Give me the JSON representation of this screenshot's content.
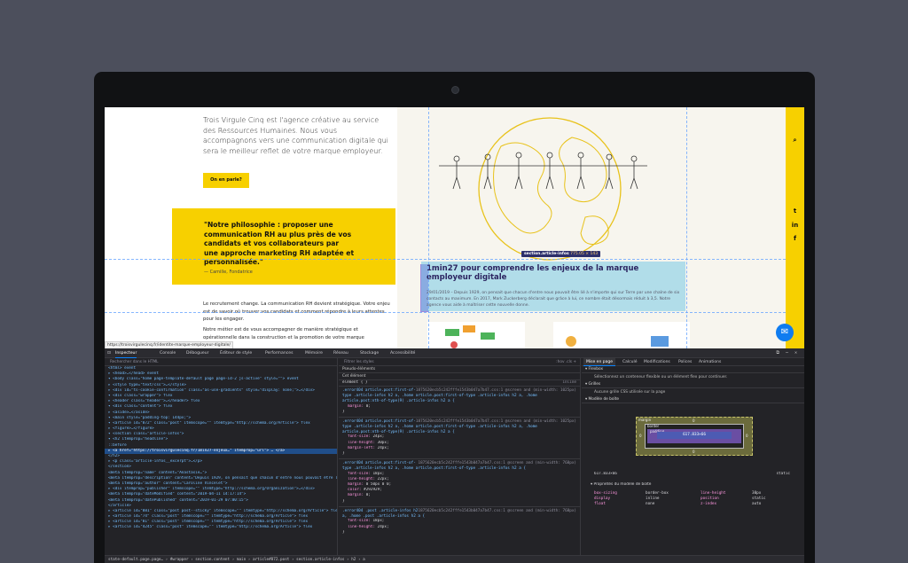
{
  "site": {
    "intro": "Trois Virgule Cinq est l'agence créative au service des Ressources Humaines. Nous vous accompagnons vers une communication digitale qui sera le meilleur reflet de votre marque employeur.",
    "cta": "On en parle?",
    "quote": "\"Notre philosophie : proposer une communication RH au plus près de vos candidats et vos collaborateurs par une approche marketing RH adaptée et personnalisée.\"",
    "quote_author": "— Camille, Fondatrice",
    "para1": "Le recrutement change. La communication RH devient stratégique. Votre enjeu est de savoir où trouver vos candidats et comment répondre à leurs attentes pour les engager.",
    "para2": "Notre métier est de vous accompagner de manière stratégique et opérationnelle dans la construction et la promotion de votre marque employeur.",
    "tooltip_label": "section.article-infos",
    "tooltip_size": "775.05 × 143",
    "article_title": "1min27 pour comprendre les enjeux de la marque employeur digitale",
    "article_excerpt": "29/01/2019 – Depuis 1929, on pensait que chacun d'entre nous pouvait être lié à n'importe qui sur Terre par une chaîne de six contacts au maximum. En 2017, Mark Zuckerberg déclarait que grâce à lui, ce nombre était désormais réduit à 3,5. Notre agence vous aide à maîtriser cette nouvelle donne.",
    "status_url": "https://troisvirgulecinq.fr/identite-marque-employeur-digitale/",
    "icons": [
      "search-icon",
      "twitter-icon",
      "linkedin-icon",
      "facebook-icon",
      "messenger-icon"
    ]
  },
  "devtools": {
    "tabs": [
      "Inspecteur",
      "Console",
      "Débogueur",
      "Éditeur de style",
      "Performances",
      "Mémoire",
      "Réseau",
      "Stockage",
      "Accessibilité"
    ],
    "search_placeholder": "Rechercher dans le HTML",
    "filter_placeholder": "Filtrer les styles",
    "filter_toggles": ":hov .cls +",
    "pseudo_header": "Pseudo-éléments",
    "this_element": "Cet élément",
    "element_rule": "élément { }",
    "inline_label": "inline",
    "html_lines": [
      "<html> event",
      "▸ <head>…</head> event",
      "▾ <body class=\"home page-template-default page page-id-2 js-active\" style=\"\"> event",
      "  ▸ <style type=\"text/css\">…</style>",
      "  ▸ <div id=\"ts-cookie-confirmation\" class=\"as-use-gradients\" style=\"display: none;\">…</div>",
      "  ▾ <div class=\"wrapper\"> flex",
      "    ▸ <header class=\"header\">…</header> flex",
      "    ▾ <div class=\"content\"> flex",
      "      ▸ <aside>…</aside>",
      "      ▾ <main style=\"padding-top: 144px;\">",
      "        ▾ <article id=\"872\" class=\"post\" itemscope=\"\" itemtype=\"http://schema.org/Article\"> flex",
      "          ▸ <figure>…</figure>",
      "          ▾ <section class=\"article-infos\">",
      "            ▾ <h2 itemprop=\"headline\">",
      "                ::before",
      "              ▸ <a href=\"https://troisvirgulecinq.fr/1min27-enjeux…\" itemprop=\"url\"> … </a>",
      "              </h2>",
      "            ▸ <p class=\"article-infos__excerpt\">…</p>",
      "          </section>",
      "          <meta itemprop=\"name\" content=\"Anastasie…\">",
      "          <meta itemprop=\"description\" content=\"Depuis 1929, on pensait que chacun d'entre nous pouvait être lié…\">",
      "          <meta itemprop=\"author\" content=\"Caroline Vincelet\">",
      "        ▸ <div itemprop=\"publisher\" itemscope=\"\" itemtype=\"http://schema.org/Organization\">…</div>",
      "          <meta itemprop=\"dateModified\" content=\"2019-04-11 14:17:14\">",
      "          <meta itemprop=\"datePublished\" content=\"2019-01-29 07:00:15\">",
      "        </article>",
      "        ▸ <article id=\"881\" class=\"post post--sticky\" itemscope=\"\" itemtype=\"http://schema.org/Article\"> flex",
      "        ▸ <article id=\"74\" class=\"post\" itemscope=\"\" itemtype=\"http://schema.org/Article\"> flex",
      "        ▸ <article id=\"81\" class=\"post\" itemscope=\"\" itemtype=\"http://schema.org/Article\"> flex",
      "        ▸ <article id=\"4245\" class=\"post\" itemscope=\"\" itemtype=\"http://schema.org/Article\"> flex"
    ],
    "breadcrumbs": "state-default.page.page… › #wrapper › section.content › main › article#872.post › section.article-infos › h2 › a",
    "css_rules": [
      {
        "sel": ".error404 article.post:first-of-type .article-infos h2 a, .home article.post:first-of-type .article-infos h2 a, .home article.post:nth-of-type(9) .article-infos h2 a",
        "src": "1875620ecb5c242fffe1543b047a7b47.css:1 @screen and (min-width: 1025px)",
        "props": [
          "margin: 0;"
        ]
      },
      {
        "sel": ".error404 article.post:first-of-type .article-infos h2 a, .home article.post:first-of-type .article-infos h2 a, .home article.post:nth-of-type(9) .article-infos h2 a",
        "src": "1875620ecb5c242fffe1543b047a7b47.css:1 @screen and (min-width: 1025px)",
        "props": [
          "font-size: 24px;",
          "line-height: 30px;",
          "margin-left: 24px;"
        ]
      },
      {
        "sel": ".error404 article.post:first-of-type .article-infos h2 a, .home article.post:first-of-type .article-infos h2 a",
        "src": "1875620ecb5c242fffe1543b047a7b47.css:1 @screen and (min-width: 768px)",
        "props": [
          "font-size: 18px;",
          "line-height: 22px;",
          "margin: 0 50px 0 0;",
          "color: #292929;",
          "margin: 0;"
        ]
      },
      {
        "sel": ".error404 .post .article-infos h2 a, .home .post .article-infos h2 a",
        "src": "1875620ecb5c242fffe1543b047a7b47.css:1 @screen and (min-width: 768px)",
        "props": [
          "font-size: 18px;",
          "line-height: 24px;"
        ]
      }
    ],
    "layout_tabs": [
      "Mise en page",
      "Calculé",
      "Modifications",
      "Polices",
      "Animations"
    ],
    "flexbox_header": "Flexbox",
    "flexbox_note": "Sélectionnez un conteneur flexible ou un élément flex pour continuer.",
    "grid_header": "Grilles",
    "grid_note": "Aucune grille CSS utilisée sur la page",
    "boxmodel_header": "Modèle de boîte",
    "bm": {
      "margin": "margin",
      "border": "border",
      "padding": "padding",
      "content": "617.833×66",
      "zero": "0"
    },
    "bm_size": "617.833×66",
    "bm_position": "static",
    "props_header": "Propriétés du modèle de boîte",
    "props": [
      [
        "box-sizing",
        "border-box",
        "line-height",
        "30px"
      ],
      [
        "display",
        "inline",
        "position",
        "static"
      ],
      [
        "float",
        "none",
        "z-index",
        "auto"
      ]
    ]
  }
}
